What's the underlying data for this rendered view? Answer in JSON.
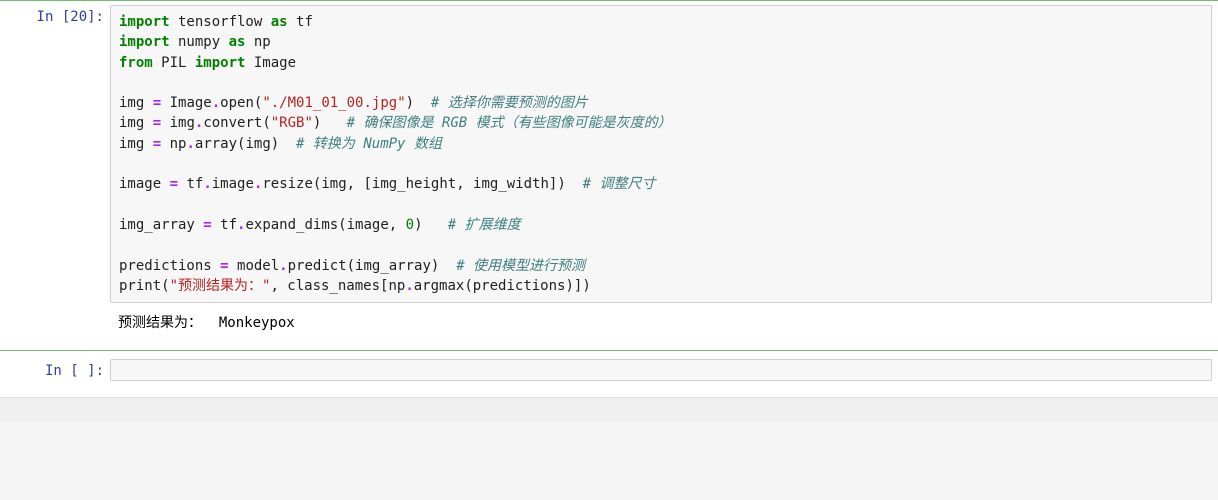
{
  "cell1": {
    "prompt_prefix": "In ",
    "exec_count": "[20]:",
    "line1_kw1": "import",
    "line1_mod1": " tensorflow ",
    "line1_kw2": "as",
    "line1_mod2": " tf",
    "line2_kw1": "import",
    "line2_mod1": " numpy ",
    "line2_kw2": "as",
    "line2_mod2": " np",
    "line3_kw1": "from",
    "line3_mod1": " PIL ",
    "line3_kw2": "import",
    "line3_mod2": " Image",
    "line5_a": "img ",
    "line5_op1": "=",
    "line5_b": " Image",
    "line5_op2": ".",
    "line5_c": "open(",
    "line5_str": "\"./M01_01_00.jpg\"",
    "line5_d": ")  ",
    "line5_com": "# 选择你需要预测的图片",
    "line6_a": "img ",
    "line6_op1": "=",
    "line6_b": " img",
    "line6_op2": ".",
    "line6_c": "convert(",
    "line6_str": "\"RGB\"",
    "line6_d": ")   ",
    "line6_com": "# 确保图像是 RGB 模式（有些图像可能是灰度的）",
    "line7_a": "img ",
    "line7_op1": "=",
    "line7_b": " np",
    "line7_op2": ".",
    "line7_c": "array(img)  ",
    "line7_com": "# 转换为 NumPy 数组",
    "line9_a": "image ",
    "line9_op1": "=",
    "line9_b": " tf",
    "line9_op2": ".",
    "line9_c": "image",
    "line9_op3": ".",
    "line9_d": "resize(img, [img_height, img_width])  ",
    "line9_com": "# 调整尺寸",
    "line11_a": "img_array ",
    "line11_op1": "=",
    "line11_b": " tf",
    "line11_op2": ".",
    "line11_c": "expand_dims(image, ",
    "line11_num": "0",
    "line11_d": ")   ",
    "line11_com": "# 扩展维度",
    "line13_a": "predictions ",
    "line13_op1": "=",
    "line13_b": " model",
    "line13_op2": ".",
    "line13_c": "predict(img_array)  ",
    "line13_com": "# 使用模型进行预测",
    "line14_a": "print",
    "line14_b": "(",
    "line14_str": "\"预测结果为：\"",
    "line14_c": ", class_names[np",
    "line14_op2": ".",
    "line14_d": "argmax(predictions)])",
    "output_text": "预测结果为：  Monkeypox"
  },
  "cell2": {
    "prompt_prefix": "In ",
    "exec_count": "[ ]:",
    "code": ""
  }
}
